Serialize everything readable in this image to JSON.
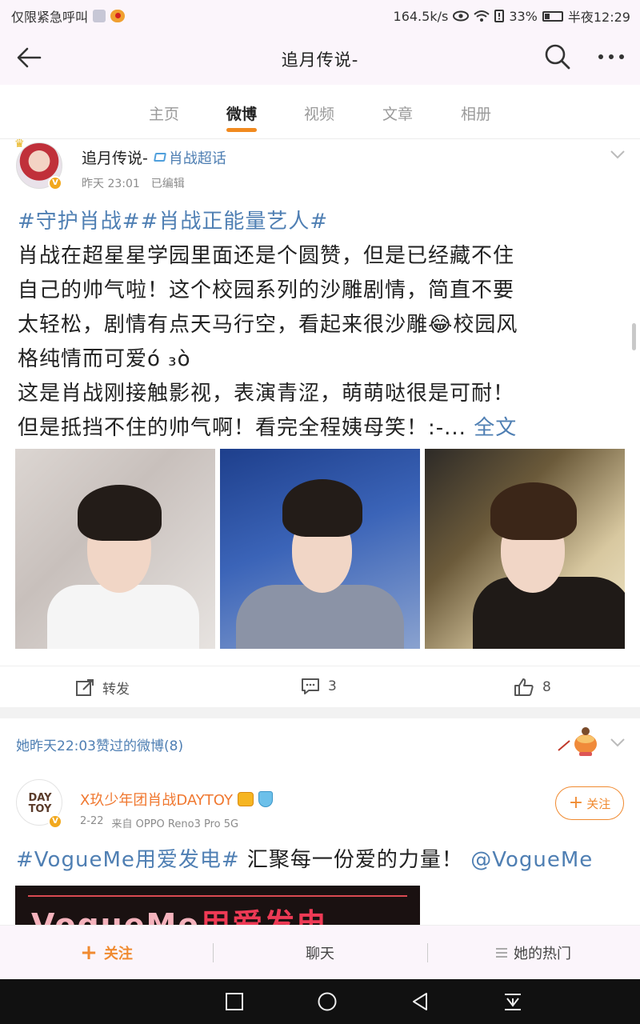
{
  "status_bar": {
    "left_text": "仅限紧急呼叫",
    "speed": "164.5k/s",
    "battery": "33%",
    "battery_level": 0.33,
    "time": "半夜12:29"
  },
  "header": {
    "title": "追月传说-",
    "icons": [
      "back-arrow-icon",
      "search-icon",
      "more-icon"
    ]
  },
  "tabs": [
    {
      "label": "主页",
      "active": false
    },
    {
      "label": "微博",
      "active": true
    },
    {
      "label": "视频",
      "active": false
    },
    {
      "label": "文章",
      "active": false
    },
    {
      "label": "相册",
      "active": false
    }
  ],
  "post1": {
    "author": "追月传说-",
    "supertopic": "肖战超话",
    "time": "昨天 23:01",
    "edited": "已编辑",
    "hashtags": "#守护肖战##肖战正能量艺人#",
    "body_lines": [
      "肖战在超星星学园里面还是个圆赞，但是已经藏不住",
      "自己的帅气啦！这个校园系列的沙雕剧情，简直不要",
      "太轻松，剧情有点天马行空，看起来很沙雕😂校园风",
      "格纯情而可爱ό ₃ὸ",
      "这是肖战刚接触影视，表演青涩，萌萌哒很是可耐！"
    ],
    "last_line": "但是抵挡不住的帅气啊！看完全程姨母笑！:-...",
    "more_link": "全文",
    "actions": {
      "repost_label": "转发",
      "comment_count": "3",
      "like_count": "8"
    }
  },
  "post2": {
    "liked_notice": "她昨天22:03赞过的微博(8)",
    "author": "X玖少年团肖战DAYTOY",
    "avatar_text": "DAY TOY",
    "date": "2-22",
    "source": "来自 OPPO Reno3 Pro 5G",
    "follow_label": "关注",
    "hashtag": "#VogueMe用爱发电#",
    "body": " 汇聚每一份爱的力量！",
    "mention": "@VogueMe",
    "banner_text_a": "VogueMe",
    "banner_text_b": "用爱发电"
  },
  "bottom_bar": {
    "follow": "关注",
    "chat": "聊天",
    "hot": "她的热门"
  },
  "colors": {
    "accent": "#f18a1f",
    "link": "#4f7fb3",
    "background": "#fbf5fb"
  }
}
